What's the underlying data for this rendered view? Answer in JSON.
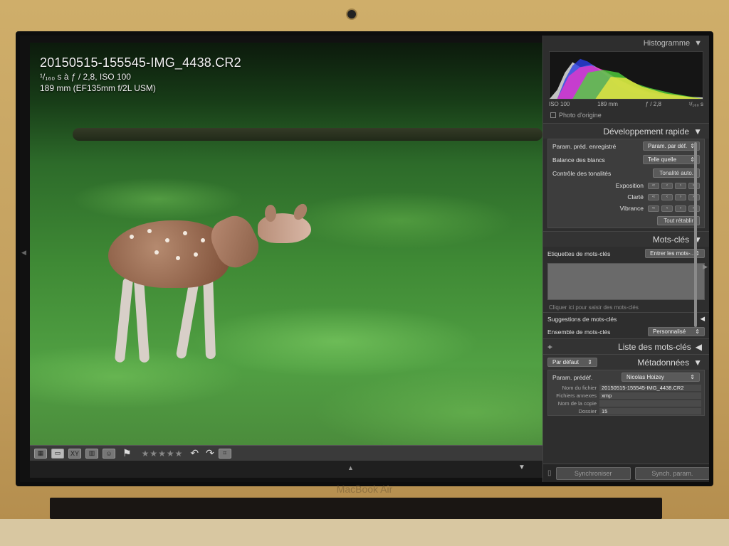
{
  "device": {
    "brand": "MacBook Air"
  },
  "photo": {
    "filename": "20150515-155545-IMG_4438.CR2",
    "exposure_line": "¹/₁₆₀ s à ƒ / 2,8, ISO 100",
    "lens_line": "189 mm (EF135mm f/2L USM)"
  },
  "toolbar": {
    "stars": "★★★★★",
    "icons": [
      "grid-icon",
      "loupe-icon",
      "compare-icon",
      "survey-icon",
      "people-icon",
      "flag-icon",
      "rotate-left-icon",
      "rotate-right-icon",
      "crop-icon"
    ]
  },
  "histogram": {
    "title": "Histogramme",
    "iso": "ISO 100",
    "focal": "189 mm",
    "aperture": "ƒ / 2,8",
    "shutter": "¹/₁₆₀ s",
    "original_photo": "Photo d'origine"
  },
  "quick_develop": {
    "title": "Développement rapide",
    "preset_label": "Param. préd. enregistré",
    "preset_value": "Param. par déf.",
    "wb_label": "Balance des blancs",
    "wb_value": "Telle quelle",
    "tone_label": "Contrôle des tonalités",
    "tone_button": "Tonalité auto.",
    "exposure_label": "Exposition",
    "clarity_label": "Clarté",
    "vibrance_label": "Vibrance",
    "reset_button": "Tout rétablir"
  },
  "keywords": {
    "title": "Mots-clés",
    "tags_label": "Etiquettes de mots-clés",
    "tags_value": "Entrer les mots-...",
    "hint": "Cliquer ici pour saisir des mots-clés",
    "suggestions": "Suggestions de mots-clés",
    "set_label": "Ensemble de mots-clés",
    "set_value": "Personnalisé"
  },
  "keyword_list": {
    "title": "Liste des mots-clés",
    "plus": "+"
  },
  "metadata": {
    "title": "Métadonnées",
    "preset_dropdown": "Par défaut",
    "preset_label": "Param. prédéf.",
    "preset_value": "Nicolas Hoizey",
    "filename_label": "Nom du fichier",
    "filename_value": "20150515-155545-IMG_4438.CR2",
    "sidecar_label": "Fichiers annexes",
    "sidecar_value": "xmp",
    "copyname_label": "Nom de la copie",
    "folder_label": "Dossier",
    "folder_value": "15"
  },
  "sync": {
    "sync_button": "Synchroniser",
    "sync_settings_button": "Synch. param."
  }
}
